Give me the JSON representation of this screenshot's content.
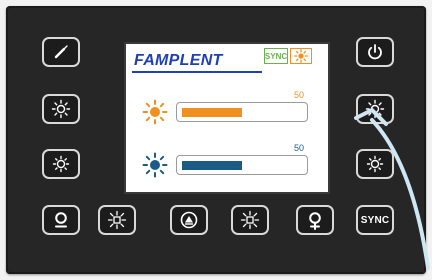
{
  "display": {
    "brand": "FAMPLENT",
    "sync_badge": "SYNC",
    "rows": [
      {
        "icon": "warm-sun-icon",
        "value": 50,
        "value_label": "50",
        "fill_color": "#f0901e"
      },
      {
        "icon": "cool-sun-icon",
        "value": 50,
        "value_label": "50",
        "fill_color": "#1b5c86"
      }
    ]
  },
  "buttons": {
    "left": [
      {
        "icon": "edit-icon"
      },
      {
        "icon": "brightness-up-icon"
      },
      {
        "icon": "brightness-down-icon"
      }
    ],
    "right": [
      {
        "icon": "power-icon"
      },
      {
        "icon": "brightness-up-icon"
      },
      {
        "icon": "brightness-down-icon"
      }
    ],
    "bottom": [
      {
        "icon": "zoom-out-icon"
      },
      {
        "icon": "cool-light-icon"
      },
      {
        "icon": "center-icon"
      },
      {
        "icon": "cool-light-icon"
      },
      {
        "icon": "zoom-in-icon"
      },
      {
        "label": "SYNC"
      }
    ]
  },
  "colors": {
    "panel": "#262626",
    "button_border": "#d9d9d9",
    "warm": "#f0901e",
    "cool": "#1b5c86",
    "brand": "#1f3fb5",
    "pointer": "#cfe6f3"
  }
}
